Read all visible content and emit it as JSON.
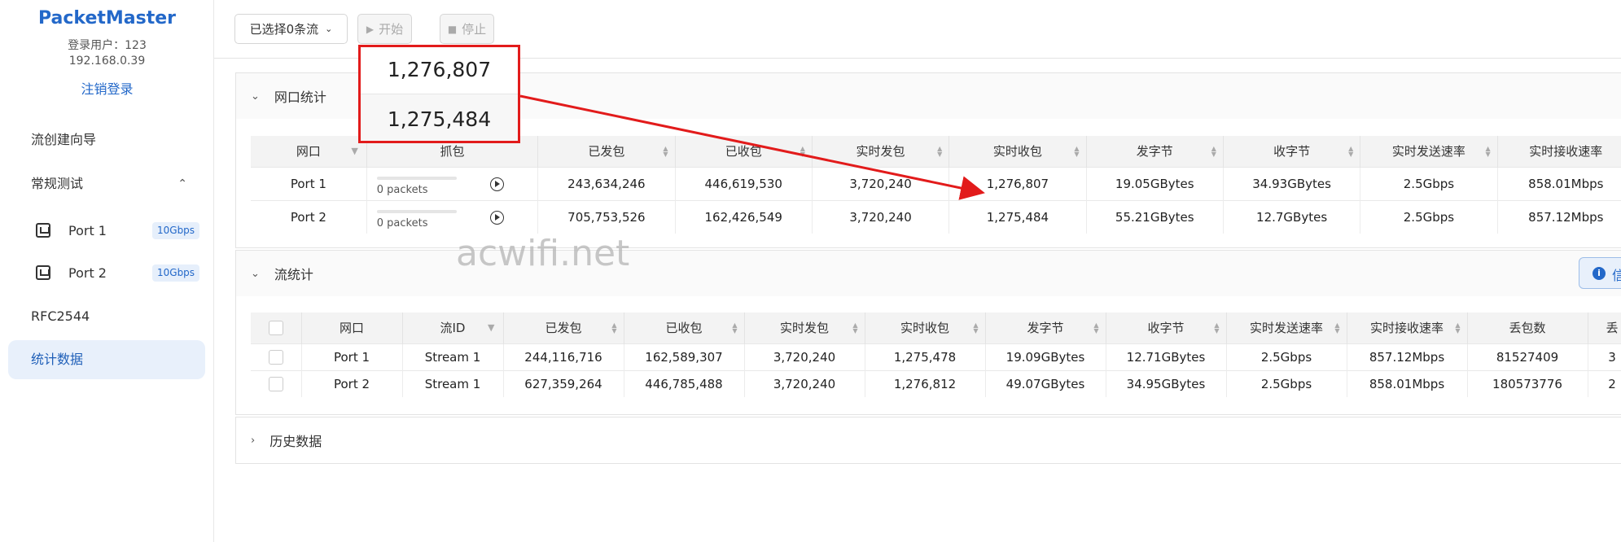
{
  "sidebar": {
    "brand": "PacketMaster",
    "login_user": "登录用户：123",
    "ip": "192.168.0.39",
    "logout": "注销登录",
    "nav": {
      "wizard": "流创建向导",
      "regular": "常规测试",
      "rfc": "RFC2544",
      "stats": "统计数据"
    },
    "ports": [
      {
        "label": "Port 1",
        "speed": "10Gbps"
      },
      {
        "label": "Port 2",
        "speed": "10Gbps"
      }
    ]
  },
  "toolbar": {
    "select_label": "已选择0条流",
    "start_label": "开始",
    "stop_label": "停止"
  },
  "port_stats": {
    "title": "网口统计",
    "headers": [
      "网口",
      "抓包",
      "已发包",
      "已收包",
      "实时发包",
      "实时收包",
      "发字节",
      "收字节",
      "实时发送速率",
      "实时接收速率"
    ],
    "rows": [
      {
        "port": "Port 1",
        "capture": "0 packets",
        "sent": "243,634,246",
        "recv": "446,619,530",
        "rt_sent": "3,720,240",
        "rt_recv": "1,276,807",
        "bytes_sent": "19.05GBytes",
        "bytes_recv": "34.93GBytes",
        "rate_tx": "2.5Gbps",
        "rate_rx": "858.01Mbps"
      },
      {
        "port": "Port 2",
        "capture": "0 packets",
        "sent": "705,753,526",
        "recv": "162,426,549",
        "rt_sent": "3,720,240",
        "rt_recv": "1,275,484",
        "bytes_sent": "55.21GBytes",
        "bytes_recv": "12.7GBytes",
        "rate_tx": "2.5Gbps",
        "rate_rx": "857.12Mbps"
      }
    ]
  },
  "flow_stats": {
    "title": "流统计",
    "info_label": "信",
    "headers": [
      "网口",
      "流ID",
      "已发包",
      "已收包",
      "实时发包",
      "实时收包",
      "发字节",
      "收字节",
      "实时发送速率",
      "实时接收速率",
      "丢包数",
      "丢"
    ],
    "rows": [
      {
        "port": "Port 1",
        "stream": "Stream 1",
        "sent": "244,116,716",
        "recv": "162,589,307",
        "rt_sent": "3,720,240",
        "rt_recv": "1,275,478",
        "bytes_sent": "19.09GBytes",
        "bytes_recv": "12.71GBytes",
        "rate_tx": "2.5Gbps",
        "rate_rx": "857.12Mbps",
        "loss": "81527409",
        "extra": "3"
      },
      {
        "port": "Port 2",
        "stream": "Stream 1",
        "sent": "627,359,264",
        "recv": "446,785,488",
        "rt_sent": "3,720,240",
        "rt_recv": "1,276,812",
        "bytes_sent": "49.07GBytes",
        "bytes_recv": "34.95GBytes",
        "rate_tx": "2.5Gbps",
        "rate_rx": "858.01Mbps",
        "loss": "180573776",
        "extra": "2"
      }
    ]
  },
  "history": {
    "title": "历史数据"
  },
  "callout": {
    "value1": "1,276,807",
    "value2": "1,275,484"
  },
  "watermark": "acwifi.net",
  "colors": {
    "accent": "#2368c9",
    "callout": "#e21b1b",
    "active_nav": "#e8f0fb"
  }
}
